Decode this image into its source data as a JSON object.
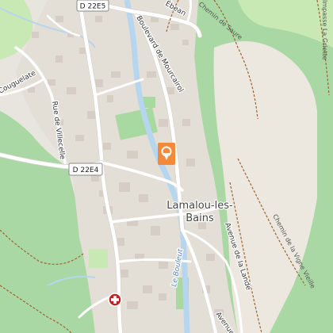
{
  "map": {
    "colors": {
      "background": "#e8e4de",
      "forest": "#a9d8a4",
      "meadow": "#c8e8b4",
      "bare": "#ece8df",
      "park": "#a7d9a0",
      "building": "#d6cdc4",
      "road": "#ffffff",
      "river": "#b6d5ef",
      "trail": "#a0622d",
      "marker": "#f28a3a",
      "hospital_red": "#c51f1f"
    },
    "labels": {
      "road_d22e5": "D 22E5",
      "road_d22e4": "D 22E4",
      "boulevard_mourcairol": "Boulevard de Mourcairol",
      "rue_villecelle": "Rue de Villecelle",
      "couguelate": "Couguelate",
      "town": "Lamalou-les-Bains",
      "town_line1": "Lamalou-les-",
      "town_line2": "Bains",
      "river_bouleut": "Le Bouleut",
      "chemin_saure": "Chemin de Saure",
      "chemin_vigne_vieille": "Chemin de la Vigne Vieille",
      "avenue_lalande": "Avenue de la Lande",
      "impasse_griette": "Impasse La Griette",
      "ebean": "Ébean",
      "avenue_partial": "Avenue de"
    },
    "markers": [
      {
        "name": "location-pin",
        "icon": "map-pin-icon"
      },
      {
        "name": "hospital",
        "icon": "hospital-cross-icon"
      }
    ]
  }
}
